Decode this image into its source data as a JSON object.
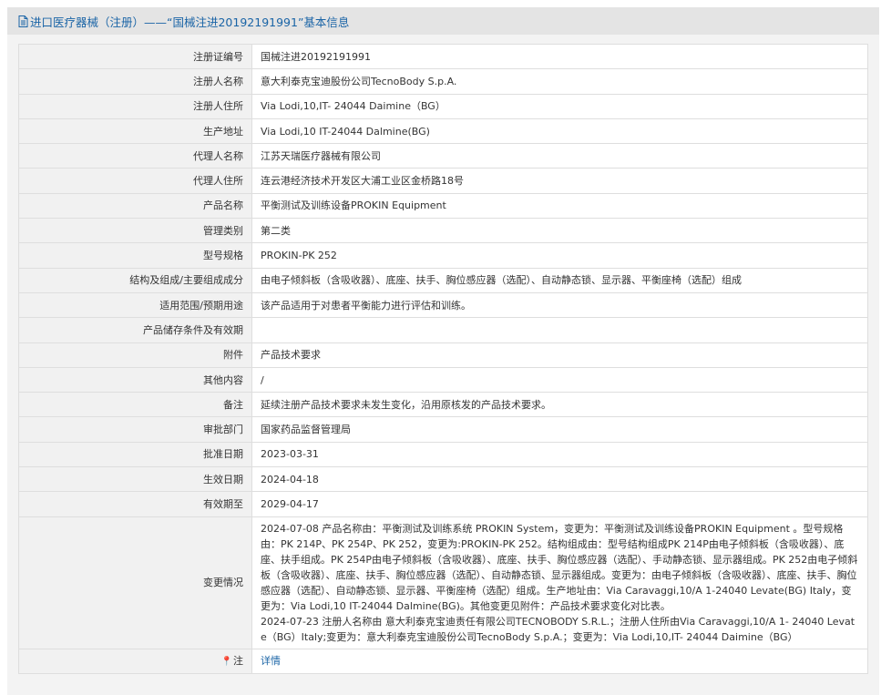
{
  "page_title": "进口医疗器械（注册）——“国械注进20192191991”基本信息",
  "fields": [
    {
      "label": "注册证编号",
      "value": "国械注进20192191991"
    },
    {
      "label": "注册人名称",
      "value": "意大利泰克宝迪股份公司TecnoBody S.p.A."
    },
    {
      "label": "注册人住所",
      "value": "Via Lodi,10,IT- 24044 Daimine（BG）"
    },
    {
      "label": "生产地址",
      "value": "Via Lodi,10 IT-24044 Dalmine(BG)"
    },
    {
      "label": "代理人名称",
      "value": "江苏天瑞医疗器械有限公司"
    },
    {
      "label": "代理人住所",
      "value": "连云港经济技术开发区大浦工业区金桥路18号"
    },
    {
      "label": "产品名称",
      "value": "平衡测试及训练设备PROKIN Equipment"
    },
    {
      "label": "管理类别",
      "value": "第二类"
    },
    {
      "label": "型号规格",
      "value": "PROKIN-PK 252"
    },
    {
      "label": "结构及组成/主要组成成分",
      "value": "由电子倾斜板（含吸收器）、底座、扶手、胸位感应器（选配）、自动静态锁、显示器、平衡座椅（选配）组成"
    },
    {
      "label": "适用范围/预期用途",
      "value": "该产品适用于对患者平衡能力进行评估和训练。"
    },
    {
      "label": "产品储存条件及有效期",
      "value": ""
    },
    {
      "label": "附件",
      "value": "产品技术要求"
    },
    {
      "label": "其他内容",
      "value": "/"
    },
    {
      "label": "备注",
      "value": "延续注册产品技术要求未发生变化，沿用原核发的产品技术要求。"
    },
    {
      "label": "审批部门",
      "value": "国家药品监督管理局"
    },
    {
      "label": "批准日期",
      "value": "2023-03-31"
    },
    {
      "label": "生效日期",
      "value": "2024-04-18"
    },
    {
      "label": "有效期至",
      "value": "2029-04-17"
    }
  ],
  "change": {
    "label": "变更情况",
    "paragraphs": [
      "2024-07-08 产品名称由：平衡测试及训练系统 PROKIN System，变更为：平衡测试及训练设备PROKIN Equipment 。型号规格由：PK 214P、PK 254P、PK 252，变更为:PROKIN-PK 252。结构组成由：型号结构组成PK 214P由电子倾斜板（含吸收器）、底座、扶手组成。PK 254P由电子倾斜板（含吸收器）、底座、扶手、胸位感应器（选配）、手动静态锁、显示器组成。PK 252由电子倾斜板（含吸收器）、底座、扶手、胸位感应器（选配）、自动静态锁、显示器组成。变更为：由电子倾斜板（含吸收器）、底座、扶手、胸位感应器（选配）、自动静态锁、显示器、平衡座椅（选配）组成。生产地址由：Via Caravaggi,10/A 1-24040 Levate(BG) Italy，变更为：Via Lodi,10 IT-24044 Dalmine(BG)。其他变更见附件：产品技术要求变化对比表。",
      "2024-07-23 注册人名称由 意大利泰克宝迪责任有限公司TECNOBODY S.R.L.；注册人住所由Via Caravaggi,10/A 1- 24040 Levate（BG）Italy;变更为：意大利泰克宝迪股份公司TecnoBody S.p.A.；变更为：Via Lodi,10,IT- 24044 Daimine（BG）"
    ]
  },
  "note": {
    "icon": "pin-icon",
    "label": "注",
    "link_text": "详情"
  },
  "colors": {
    "link": "#1a64a6",
    "title_bg": "#e4e4e4",
    "panel_bg": "#f3f3f3",
    "label_bg": "#f1f1f1",
    "border": "#dedede"
  }
}
